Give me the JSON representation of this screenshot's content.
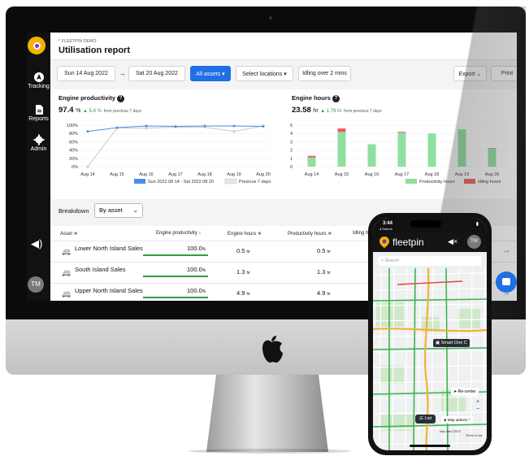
{
  "app": {
    "org": "* FLEETPIN DEMO",
    "title": "Utilisation report",
    "sidebar": [
      {
        "label": "Tracking",
        "icon": "navigation-icon"
      },
      {
        "label": "Reports",
        "icon": "document-icon"
      },
      {
        "label": "Admin",
        "icon": "gear-icon"
      }
    ],
    "avatar": "TM"
  },
  "toolbar": {
    "start_date": "Sun 14 Aug 2022",
    "arrow": "→",
    "end_date": "Sat 20 Aug 2022",
    "assets": "All assets ▾",
    "locations": "Select locations ▾",
    "idling": "Idling over 2 mins",
    "export": "Export ⌄",
    "print": "Print"
  },
  "productivity": {
    "title": "Engine productivity",
    "value": "97.4",
    "unit": "%",
    "delta": "▲ 5.4 %",
    "delta_note": "from previous 7 days",
    "legend": [
      "Sun 2022 08 14 - Sat 2022 08 20",
      "Previous 7 days"
    ]
  },
  "hours": {
    "title": "Engine hours",
    "value": "23.58",
    "unit": "hr",
    "delta": "▲ 1.76 hr",
    "delta_note": "from previous 7 days",
    "legend": [
      "Productivity hours",
      "Idling hours"
    ]
  },
  "chart_data": [
    {
      "type": "line",
      "title": "Engine productivity",
      "categories": [
        "Aug 14",
        "Aug 15",
        "Aug 16",
        "Aug 17",
        "Aug 18",
        "Aug 19",
        "Aug 20"
      ],
      "y_ticks": [
        "100%",
        "80%",
        "60%",
        "40%",
        "20%",
        "0%"
      ],
      "ylim": [
        0,
        100
      ],
      "series": [
        {
          "name": "Sun 2022 08 14 - Sat 2022 08 20",
          "values": [
            85,
            94,
            98,
            97,
            98,
            98,
            97
          ],
          "color": "#4a90e2"
        },
        {
          "name": "Previous 7 days",
          "values": [
            0,
            93,
            93,
            95,
            95,
            85,
            98
          ],
          "color": "#c8c8c8"
        }
      ],
      "legend": "bottom"
    },
    {
      "type": "bar",
      "title": "Engine hours",
      "categories": [
        "Aug 14",
        "Aug 15",
        "Aug 16",
        "Aug 17",
        "Aug 18",
        "Aug 19",
        "Aug 20"
      ],
      "y_ticks": [
        "5",
        "4",
        "3",
        "2",
        "1",
        "0"
      ],
      "ylim": [
        0,
        5
      ],
      "series": [
        {
          "name": "Productivity hours",
          "values": [
            1.1,
            4.2,
            2.7,
            4.1,
            4.0,
            4.5,
            2.2
          ],
          "color": "#8fe0a0"
        },
        {
          "name": "Idling hours",
          "values": [
            0.2,
            0.4,
            0.0,
            0.1,
            0.0,
            0.0,
            0.05
          ],
          "color": "#f05a5a"
        }
      ],
      "legend": "bottom-right"
    }
  ],
  "breakdown": {
    "label": "Breakdown",
    "select": "By asset"
  },
  "table": {
    "headers": [
      "Asset ≑",
      "Engine productivity ↓",
      "Engine hours ≑",
      "Productivity hours ≑",
      "Idling ho"
    ],
    "rows": [
      {
        "asset": "Lower North Island Sales",
        "productivity": "100.0",
        "pct": "%",
        "engine_hours": "0.5",
        "prod_hours": "0.5",
        "unit": "hr",
        "fill": 1.0
      },
      {
        "asset": "South Island Sales",
        "productivity": "100.0",
        "pct": "%",
        "engine_hours": "1.3",
        "prod_hours": "1.3",
        "unit": "hr",
        "fill": 1.0
      },
      {
        "asset": "Upper North Island Sales",
        "productivity": "100.0",
        "pct": "%",
        "engine_hours": "4.9",
        "prod_hours": "4.9",
        "unit": "hr",
        "fill": 1.0
      }
    ]
  },
  "phone": {
    "time": "3:44",
    "back": "◂ Search",
    "brand": "fleetpin",
    "avatar": "TM",
    "search_placeholder": "Search",
    "vehicle": "Smart One C",
    "recenter": "Re-center",
    "list": "List",
    "map_options": "Map options ^",
    "map_credit": "Map data ©2022",
    "terms": "Terms of Use"
  }
}
